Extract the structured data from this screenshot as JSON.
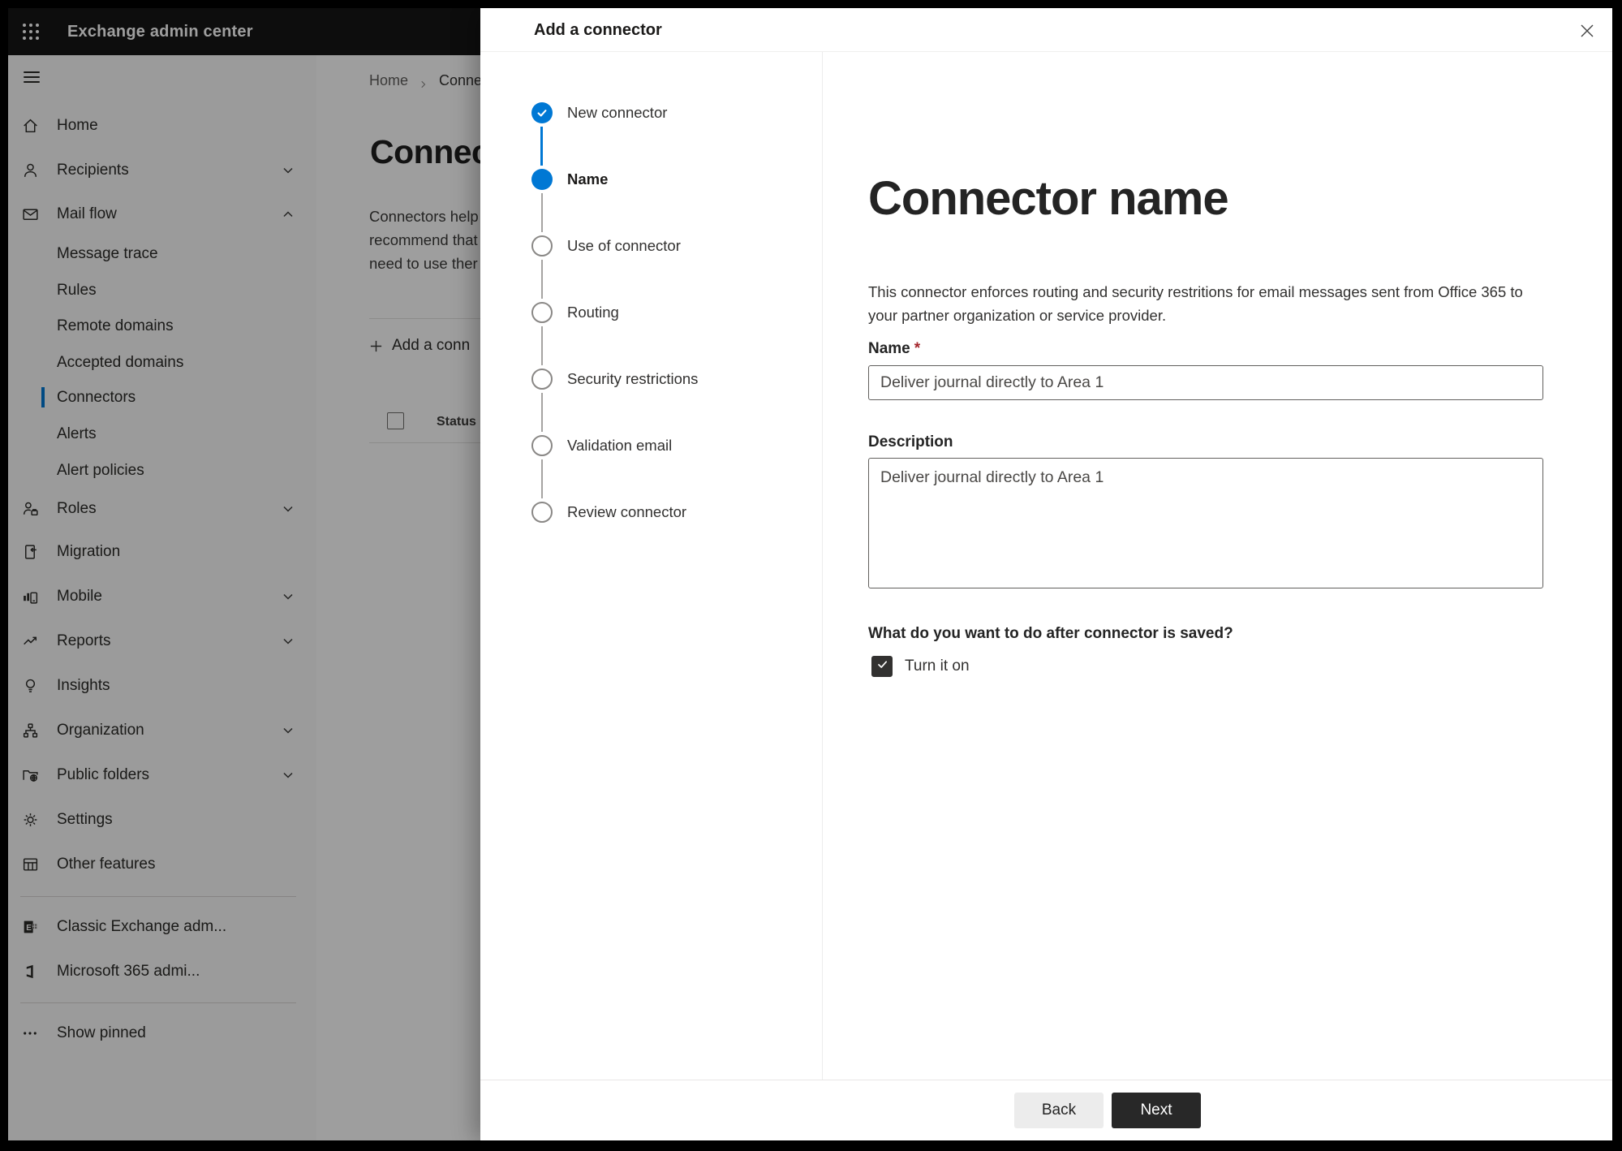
{
  "topbar": {
    "title": "Exchange admin center"
  },
  "sidebar": {
    "items": [
      {
        "label": "Home",
        "icon": "home-icon"
      },
      {
        "label": "Recipients",
        "icon": "person-icon",
        "chevron": "down"
      },
      {
        "label": "Mail flow",
        "icon": "mail-icon",
        "chevron": "up",
        "expanded": true
      },
      {
        "label": "Message trace",
        "sub": true
      },
      {
        "label": "Rules",
        "sub": true
      },
      {
        "label": "Remote domains",
        "sub": true
      },
      {
        "label": "Accepted domains",
        "sub": true
      },
      {
        "label": "Connectors",
        "sub": true,
        "selected": true
      },
      {
        "label": "Alerts",
        "sub": true
      },
      {
        "label": "Alert policies",
        "sub": true
      },
      {
        "label": "Roles",
        "icon": "roles-icon",
        "chevron": "down"
      },
      {
        "label": "Migration",
        "icon": "migration-icon"
      },
      {
        "label": "Mobile",
        "icon": "mobile-icon",
        "chevron": "down"
      },
      {
        "label": "Reports",
        "icon": "reports-icon",
        "chevron": "down"
      },
      {
        "label": "Insights",
        "icon": "lightbulb-icon"
      },
      {
        "label": "Organization",
        "icon": "org-tree-icon",
        "chevron": "down"
      },
      {
        "label": "Public folders",
        "icon": "folder-globe-icon",
        "chevron": "down"
      },
      {
        "label": "Settings",
        "icon": "gear-icon"
      },
      {
        "label": "Other features",
        "icon": "table-icon"
      },
      {
        "label": "Classic Exchange adm...",
        "icon": "classic-exchange-icon"
      },
      {
        "label": "Microsoft 365 admi...",
        "icon": "microsoft-365-icon"
      },
      {
        "label": "Show pinned",
        "icon": "ellipsis-icon"
      }
    ]
  },
  "page": {
    "breadcrumb": {
      "home": "Home",
      "current": "Conne"
    },
    "title": "Connec",
    "intro_lines": [
      "Connectors help",
      "recommend that",
      "need to use ther"
    ],
    "add_button": "Add a conn",
    "status_header": "Status"
  },
  "dialog": {
    "title": "Add a connector",
    "steps": [
      {
        "label": "New connector",
        "state": "done"
      },
      {
        "label": "Name",
        "state": "current"
      },
      {
        "label": "Use of connector",
        "state": "upcoming"
      },
      {
        "label": "Routing",
        "state": "upcoming"
      },
      {
        "label": "Security restrictions",
        "state": "upcoming"
      },
      {
        "label": "Validation email",
        "state": "upcoming"
      },
      {
        "label": "Review connector",
        "state": "upcoming"
      }
    ],
    "content": {
      "heading": "Connector name",
      "description": "This connector enforces routing and security restritions for email messages sent from Office 365 to your partner organization or service provider.",
      "name_label": "Name",
      "required_marker": "*",
      "name_value": "Deliver journal directly to Area 1",
      "description_label": "Description",
      "description_value": "Deliver journal directly to Area 1",
      "after_save_question": "What do you want to do after connector is saved?",
      "turn_on_label": "Turn it on",
      "turn_on_checked": "true"
    },
    "footer": {
      "back_label": "Back",
      "next_label": "Next"
    }
  },
  "colors": {
    "accent": "#0078d4",
    "required": "#a4262c",
    "next_button": "#282828",
    "topbar": "#161616"
  }
}
